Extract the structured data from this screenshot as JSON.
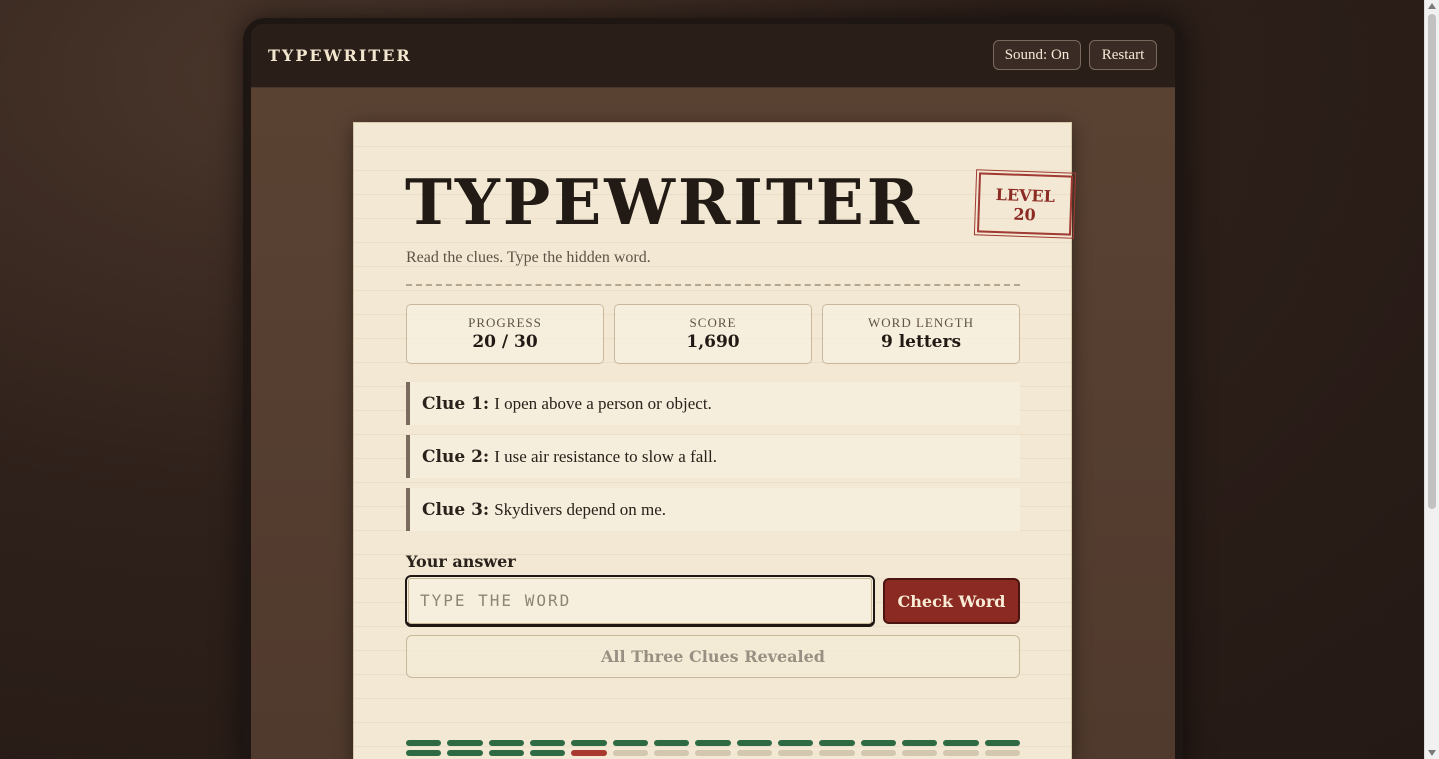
{
  "header": {
    "brand": "TYPEWRITER",
    "sound_label": "Sound: On",
    "restart_label": "Restart"
  },
  "game": {
    "title": "TYPEWRITER",
    "subtitle": "Read the clues. Type the hidden word.",
    "stamp_line1": "LEVEL",
    "stamp_line2": "20"
  },
  "stats": [
    {
      "label": "PROGRESS",
      "value": "20 / 30"
    },
    {
      "label": "SCORE",
      "value": "1,690"
    },
    {
      "label": "WORD LENGTH",
      "value": "9 letters"
    }
  ],
  "clues": [
    {
      "label": "Clue 1:",
      "text": "I open above a person or object."
    },
    {
      "label": "Clue 2:",
      "text": "I use air resistance to slow a fall."
    },
    {
      "label": "Clue 3:",
      "text": "Skydivers depend on me."
    }
  ],
  "answer": {
    "label": "Your answer",
    "placeholder": "TYPE THE WORD",
    "value": "",
    "check_label": "Check Word",
    "reveal_label": "All Three Clues Revealed"
  },
  "level_progress": {
    "total": 30,
    "completed": 19,
    "current": 20
  },
  "colors": {
    "done": "#2e6b45",
    "current": "#a83a30",
    "pending": "#d3c7b0",
    "accent": "#8b2a22"
  }
}
